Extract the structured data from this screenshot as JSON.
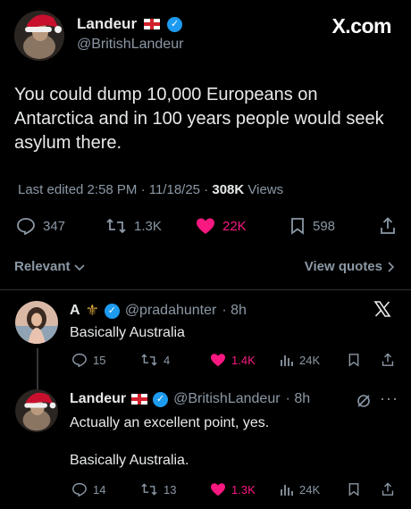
{
  "brand": {
    "site": "X.com"
  },
  "tweet": {
    "author_name": "Landeur",
    "author_handle": "@BritishLandeur",
    "text_lines": [
      "You could dump 10,000 Europeans on",
      "Antarctica and in 100 years people would seek",
      "asylum there."
    ],
    "edited": "Last edited 2:58 PM · 11/18/25 ·",
    "views_count": "308K",
    "views_label": "Views",
    "replies": "347",
    "reposts": "1.3K",
    "likes": "22K",
    "bookmarks": "598"
  },
  "sort": {
    "label": "Relevant",
    "view_quotes": "View quotes"
  },
  "replies": [
    {
      "name": "A",
      "handle": "@pradahunter",
      "time": "· 8h",
      "text": "Basically Australia",
      "replies": "15",
      "reposts": "4",
      "likes": "1.4K",
      "views": "24K"
    },
    {
      "name": "Landeur",
      "handle": "@BritishLandeur",
      "time": "· 8h",
      "text_lines": [
        "Actually an excellent point, yes.",
        "",
        "Basically Australia."
      ],
      "replies": "14",
      "reposts": "13",
      "likes": "1.3K",
      "views": "24K"
    }
  ],
  "colors": {
    "like": "#f91880",
    "verified": "#1d9bf0",
    "muted": "#8b98a5"
  }
}
